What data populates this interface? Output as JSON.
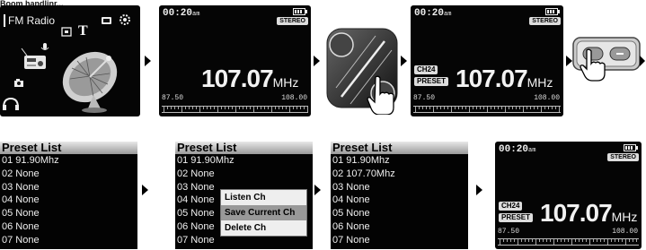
{
  "top_label": "Boom handlinr...",
  "menu": {
    "title": "FM Radio",
    "icons": [
      "radio-icon",
      "microphone-icon",
      "photo-icon",
      "text-icon",
      "video-icon",
      "settings-icon",
      "camera-icon",
      "headphones-icon",
      "satellite-dish-icon"
    ]
  },
  "radio1": {
    "time": "00:20",
    "ampm": "am",
    "stereo": "STEREO",
    "freq": "107.07",
    "unit": "MHz",
    "range_min": "87.50",
    "range_max": "108.00"
  },
  "radio2": {
    "time": "00:20",
    "ampm": "am",
    "stereo": "STEREO",
    "channel": "CH24",
    "preset": "PRESET",
    "freq": "107.07",
    "unit": "MHz",
    "range_min": "87.50",
    "range_max": "108.00"
  },
  "radio3": {
    "time": "00:20",
    "ampm": "am",
    "stereo": "STEREO",
    "channel": "CH24",
    "preset": "PRESET",
    "freq": "107.07",
    "unit": "MHz",
    "range_min": "87.50",
    "range_max": "108.00"
  },
  "preset1": {
    "title": "Preset List",
    "rows": [
      "01 91.90Mhz",
      "02 None",
      "03 None",
      "04 None",
      "05 None",
      "06 None",
      "07 None"
    ]
  },
  "preset2": {
    "title": "Preset List",
    "rows": [
      "01 91.90Mhz",
      "02 None",
      "03 None",
      "04 None",
      "05 None",
      "06 None",
      "07 None"
    ],
    "popup": [
      "Listen Ch",
      "Save Current Ch",
      "Delete Ch"
    ],
    "popup_selected": "Save Current Ch"
  },
  "preset3": {
    "title": "Preset List",
    "rows": [
      "01 91.90Mhz",
      "02 107.70Mhz",
      "03 None",
      "04 None",
      "05 None",
      "06 None",
      "07 None"
    ]
  },
  "colors": {
    "screen": "#050505",
    "text": "#f0f0f0",
    "highlight": "#999999"
  }
}
